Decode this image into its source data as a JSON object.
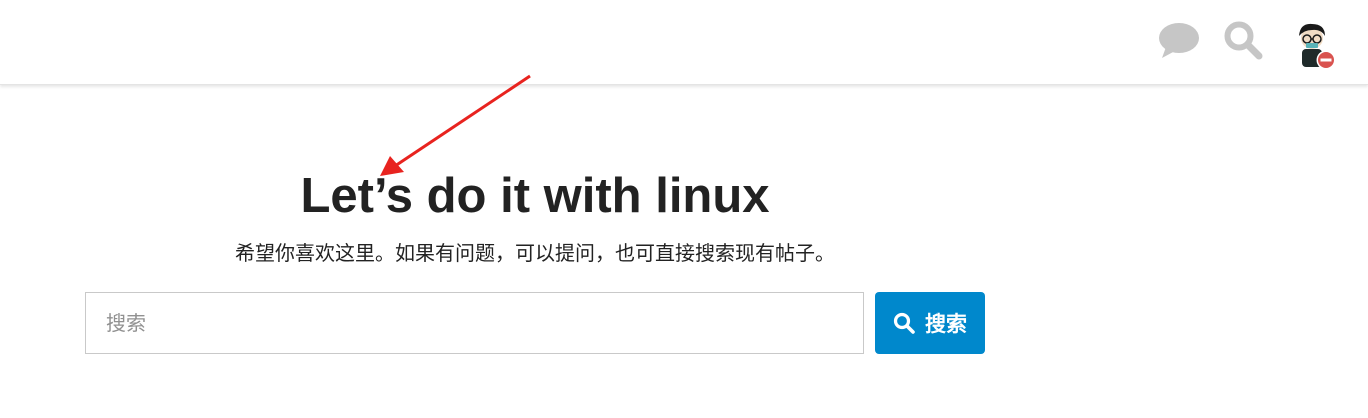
{
  "header": {
    "icons": {
      "chat": "chat-bubble-icon",
      "search": "search-icon",
      "avatar_status": "do-not-disturb-icon"
    },
    "icon_color": "#c6c6c6"
  },
  "hero": {
    "title": "Let’s do it with linux",
    "subtitle": "希望你喜欢这里。如果有问题，可以提问，也可直接搜索现有帖子。"
  },
  "search": {
    "placeholder": "搜索",
    "button_label": "搜索",
    "button_color": "#0088cc"
  },
  "annotation": {
    "arrow_color": "#e8231f"
  }
}
